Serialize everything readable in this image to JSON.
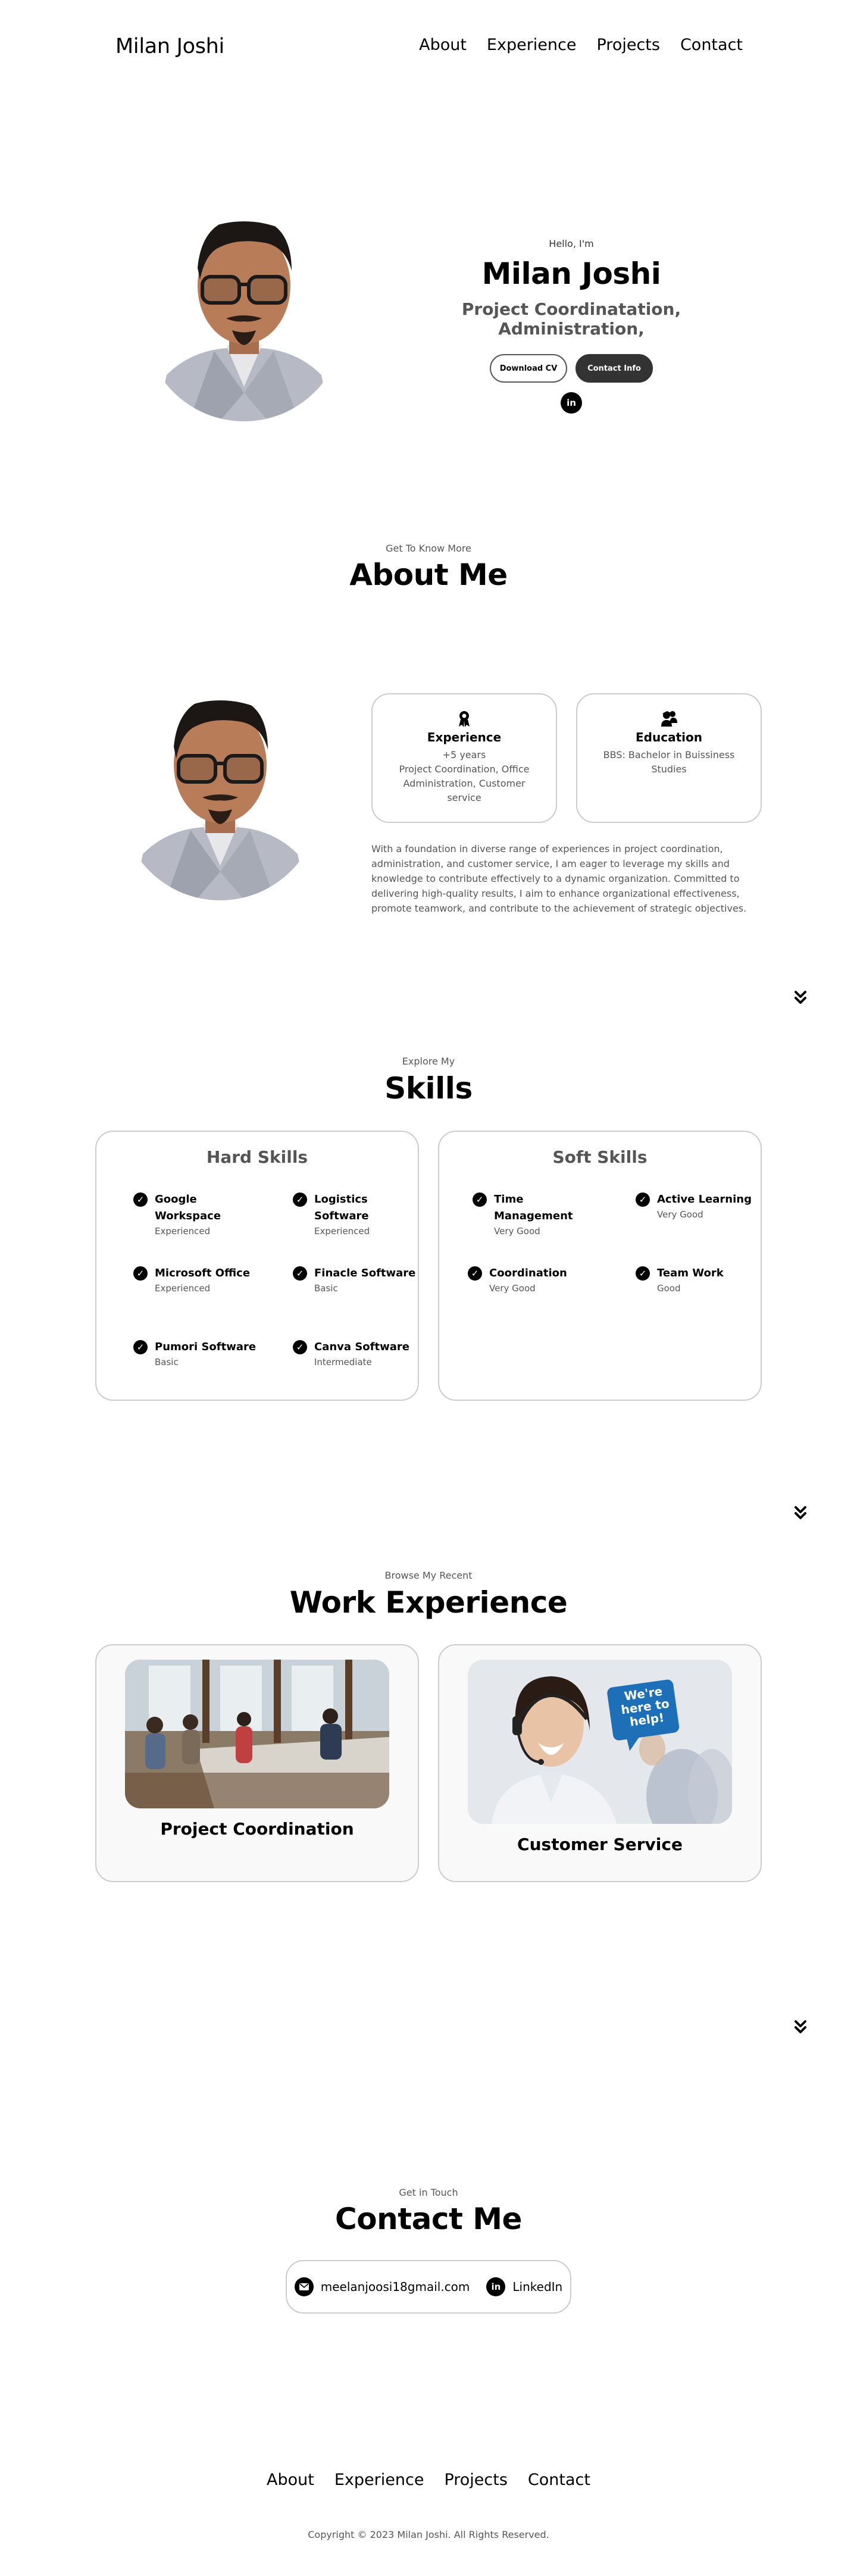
{
  "nav": {
    "logo": "Milan Joshi",
    "links": [
      "About",
      "Experience",
      "Projects",
      "Contact"
    ]
  },
  "hero": {
    "greeting": "Hello, I'm",
    "name": "Milan Joshi",
    "title": "Project Coordinatation, Administration,",
    "download_cv": "Download CV",
    "contact_info": "Contact Info",
    "social_icon": "linkedin-icon",
    "social_glyph": "in"
  },
  "about": {
    "subtitle": "Get To Know More",
    "title": "About Me",
    "cards": [
      {
        "icon": "experience-icon",
        "heading": "Experience",
        "lines": [
          "+5 years",
          "Project Coordination, Office Administration, Customer service"
        ]
      },
      {
        "icon": "education-icon",
        "heading": "Education",
        "lines": [
          "BBS: Bachelor in Buissiness Studies"
        ]
      }
    ],
    "paragraph": "With a foundation in diverse range of experiences in project coordination, administration, and customer service, I am eager to leverage my skills and knowledge to contribute effectively to a dynamic organization. Committed to delivering high-quality results, I aim to enhance organizational effectiveness, promote teamwork, and contribute to the achievement of strategic objectives."
  },
  "skills": {
    "subtitle": "Explore My",
    "title": "Skills",
    "hard": {
      "title": "Hard Skills",
      "items": [
        {
          "name": "Google Workspace",
          "level": "Experienced"
        },
        {
          "name": "Logistics Software",
          "level": "Experienced"
        },
        {
          "name": "Microsoft Office",
          "level": "Experienced"
        },
        {
          "name": "Finacle Software",
          "level": "Basic"
        },
        {
          "name": "Pumori Software",
          "level": "Basic"
        },
        {
          "name": "Canva Software",
          "level": "Intermediate"
        }
      ]
    },
    "soft": {
      "title": "Soft Skills",
      "items": [
        {
          "name": "Time Management",
          "level": "Very Good"
        },
        {
          "name": "Active Learning",
          "level": "Very Good"
        },
        {
          "name": "Coordination",
          "level": "Very Good"
        },
        {
          "name": "Team Work",
          "level": "Good"
        }
      ]
    }
  },
  "work": {
    "subtitle": "Browse My Recent",
    "title": "Work Experience",
    "items": [
      {
        "title": "Project Coordination"
      },
      {
        "title": "Customer Service",
        "badge": "We're here to help!"
      }
    ]
  },
  "contact": {
    "subtitle": "Get in Touch",
    "title": "Contact Me",
    "email": "meelanjoosi18gmail.com",
    "linkedin": "LinkedIn",
    "email_icon": "mail-icon",
    "linkedin_icon": "linkedin-icon",
    "linkedin_glyph": "in"
  },
  "footer": {
    "links": [
      "About",
      "Experience",
      "Projects",
      "Contact"
    ],
    "copyright": "Copyright © 2023 Milan Joshi. All Rights Reserved."
  },
  "colors": {
    "text": "#000000",
    "muted": "#555555",
    "border": "#cccccc",
    "dark_button": "#333333",
    "card_bg": "#f9f9f9"
  }
}
